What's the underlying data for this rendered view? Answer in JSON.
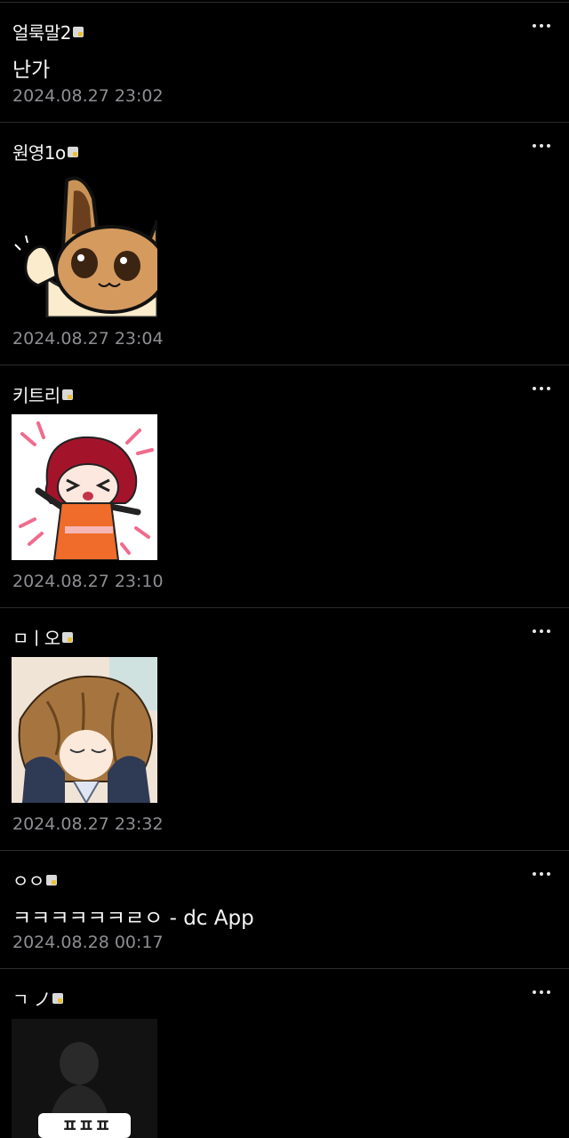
{
  "comments": [
    {
      "author": "얼룩말2",
      "text": "난가",
      "time": "2024.08.27 23:02"
    },
    {
      "author": "원영1o",
      "time": "2024.08.27 23:04",
      "sticker": "eevee-sticker"
    },
    {
      "author": "키트리",
      "time": "2024.08.27 23:10",
      "sticker": "red-hair-girl-sticker"
    },
    {
      "author": "ㅁㅣ오",
      "time": "2024.08.27 23:32",
      "sticker": "hair-flip-girl-sticker"
    },
    {
      "author": "ㅇㅇ",
      "text": "ㅋㅋㅋㅋㅋㅋㄹㅇ - dc App",
      "time": "2024.08.28 00:17"
    },
    {
      "author": "ㄱ ノ",
      "sticker": "dark-figure-sticker",
      "sticker_caption": "ㅍㅍㅍ"
    }
  ],
  "icons": {
    "more": "more-dots-icon",
    "badge": "user-badge-icon"
  }
}
